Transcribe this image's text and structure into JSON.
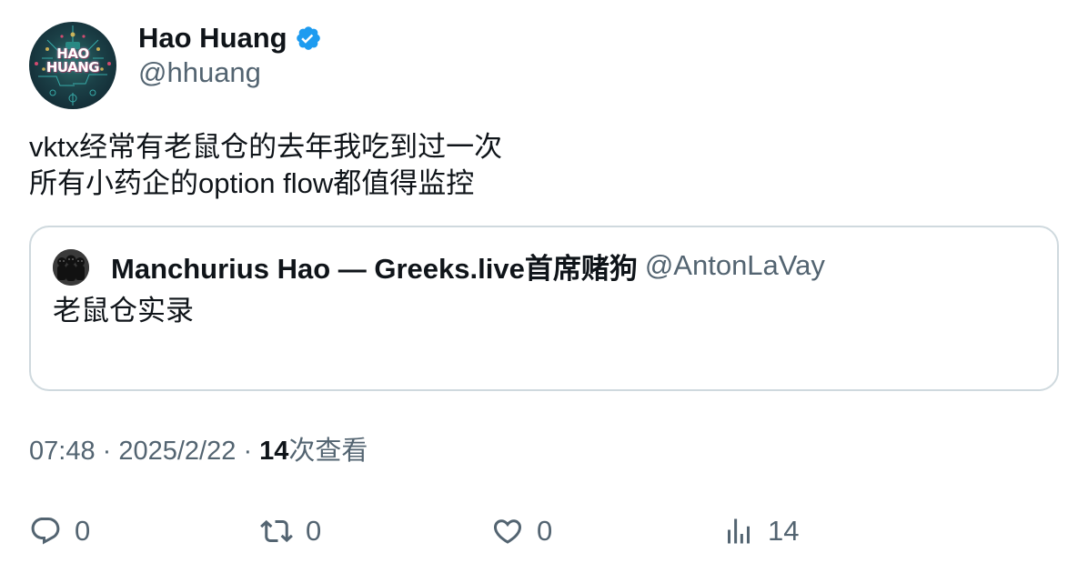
{
  "author": {
    "name": "Hao Huang",
    "handle": "@hhuang",
    "verified": true,
    "avatar_text_line1": "HAO",
    "avatar_text_line2": "HUANG"
  },
  "tweet": {
    "lines": [
      "vktx经常有老鼠仓的去年我吃到过一次",
      "所有小药企的option flow都值得监控"
    ]
  },
  "quote": {
    "author_name": "Manchurius Hao — Greeks.live首席赌狗",
    "author_handle": "@AntonLaVay",
    "text": "老鼠仓实录"
  },
  "meta": {
    "time": "07:48",
    "separator": "·",
    "date": "2025/2/22",
    "views_count": "14",
    "views_label": "次查看"
  },
  "actions": {
    "reply": {
      "icon": "reply-icon",
      "count": "0"
    },
    "retweet": {
      "icon": "retweet-icon",
      "count": "0"
    },
    "like": {
      "icon": "heart-icon",
      "count": "0"
    },
    "views": {
      "icon": "analytics-icon",
      "count": "14"
    }
  },
  "colors": {
    "text_primary": "#0f1419",
    "text_secondary": "#536471",
    "verified_blue": "#1d9bf0",
    "border": "#cfd9de"
  }
}
